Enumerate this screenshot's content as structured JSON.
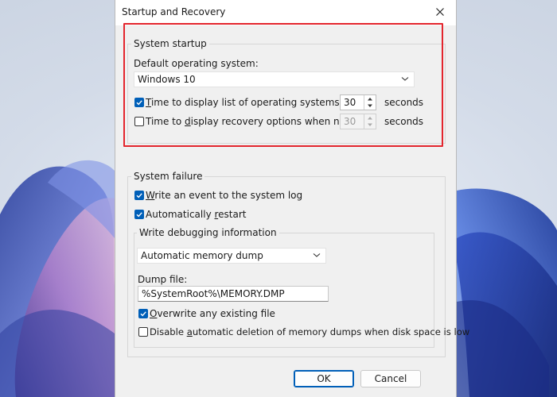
{
  "dialog": {
    "title": "Startup and Recovery",
    "close_icon": "close-icon"
  },
  "system_startup": {
    "legend": "System startup",
    "default_os_label": "Default operating system:",
    "default_os_value": "Windows 10",
    "time_list": {
      "checked": true,
      "label_prefix": "",
      "label_access": "T",
      "label_rest": "ime to display list of operating systems:",
      "value": "30",
      "unit": "seconds"
    },
    "time_recovery": {
      "checked": false,
      "label_prefix": "Time to ",
      "label_access": "d",
      "label_rest": "isplay recovery options when needed:",
      "value": "30",
      "unit": "seconds"
    }
  },
  "system_failure": {
    "legend": "System failure",
    "write_event": {
      "checked": true,
      "label_access": "W",
      "label_rest": "rite an event to the system log"
    },
    "auto_restart": {
      "checked": true,
      "label_prefix": "Automatically ",
      "label_access": "r",
      "label_rest": "estart"
    },
    "debug": {
      "legend": "Write debugging information",
      "dump_type": "Automatic memory dump",
      "dump_file_label": "Dump file:",
      "dump_file_value": "%SystemRoot%\\MEMORY.DMP",
      "overwrite": {
        "checked": true,
        "label_access": "O",
        "label_rest": "verwrite any existing file"
      },
      "disable_auto_delete": {
        "checked": false,
        "label_prefix": "Disable ",
        "label_access": "a",
        "label_rest": "utomatic deletion of memory dumps when disk space is low"
      }
    }
  },
  "buttons": {
    "ok": "OK",
    "cancel": "Cancel"
  },
  "colors": {
    "accent": "#005fb8",
    "highlight": "#e3252d"
  }
}
